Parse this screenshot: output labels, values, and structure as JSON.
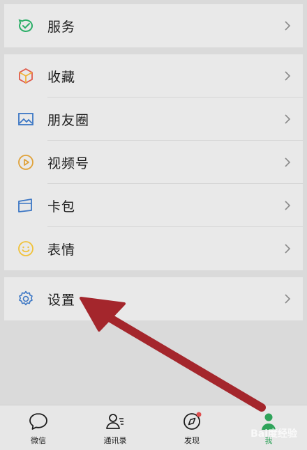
{
  "menu": {
    "group1": [
      {
        "label": "服务",
        "icon": "service-icon",
        "color": "#2aae67"
      }
    ],
    "group2": [
      {
        "label": "收藏",
        "icon": "favorites-cube-icon",
        "color": "#e05a4a"
      },
      {
        "label": "朋友圈",
        "icon": "moments-picture-icon",
        "color": "#3b76c4"
      },
      {
        "label": "视频号",
        "icon": "channels-play-icon",
        "color": "#e0a23a"
      },
      {
        "label": "卡包",
        "icon": "card-wallet-icon",
        "color": "#3b76c4"
      },
      {
        "label": "表情",
        "icon": "sticker-smile-icon",
        "color": "#f0c23a"
      }
    ],
    "group3": [
      {
        "label": "设置",
        "icon": "settings-gear-icon",
        "color": "#3b76c4"
      }
    ]
  },
  "tabbar": {
    "items": [
      {
        "label": "微信",
        "icon": "chat-bubble-icon",
        "active": false
      },
      {
        "label": "通讯录",
        "icon": "contacts-icon",
        "active": false
      },
      {
        "label": "发现",
        "icon": "discover-compass-icon",
        "active": false,
        "badge": true
      },
      {
        "label": "我",
        "icon": "me-person-icon",
        "active": true
      }
    ]
  },
  "annotation": {
    "arrow_color": "#a4262c"
  },
  "watermark": "Bai度经验"
}
